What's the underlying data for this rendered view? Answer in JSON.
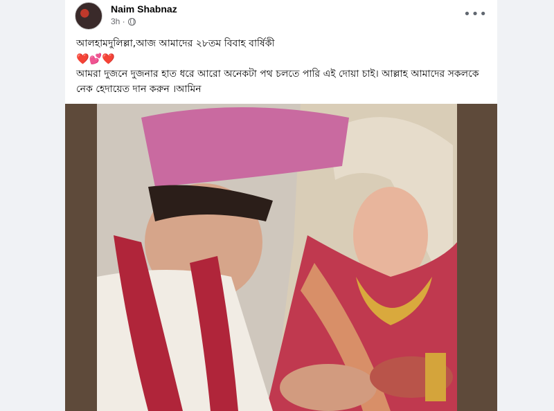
{
  "post": {
    "author": "Naim Shabnaz",
    "time": "3h ·",
    "more_label": "•••",
    "line1": "আলহামদুলিল্লা,আজ আমাদের ২৮তম বিবাহ বার্ষিকী",
    "hearts": "❤️💕❤️",
    "line2": "আমরা দুজনে দুজনার হাত ধরে আরো অনেকটা পথ চলতে পারি এই দোয়া চাই। আল্লাহ আমাদের সকলকে নেক হেদায়েত দান করুন ।আমিন"
  },
  "icons": {
    "avatar": "profile-avatar",
    "globe": "globe-icon",
    "more": "more-options-icon"
  },
  "colors": {
    "page_bg": "#f0f2f5",
    "card_bg": "#ffffff",
    "text": "#050505",
    "meta": "#65676b",
    "turban": "#c96aa0",
    "garland": "#b0253a",
    "saree": "#c0394f"
  }
}
